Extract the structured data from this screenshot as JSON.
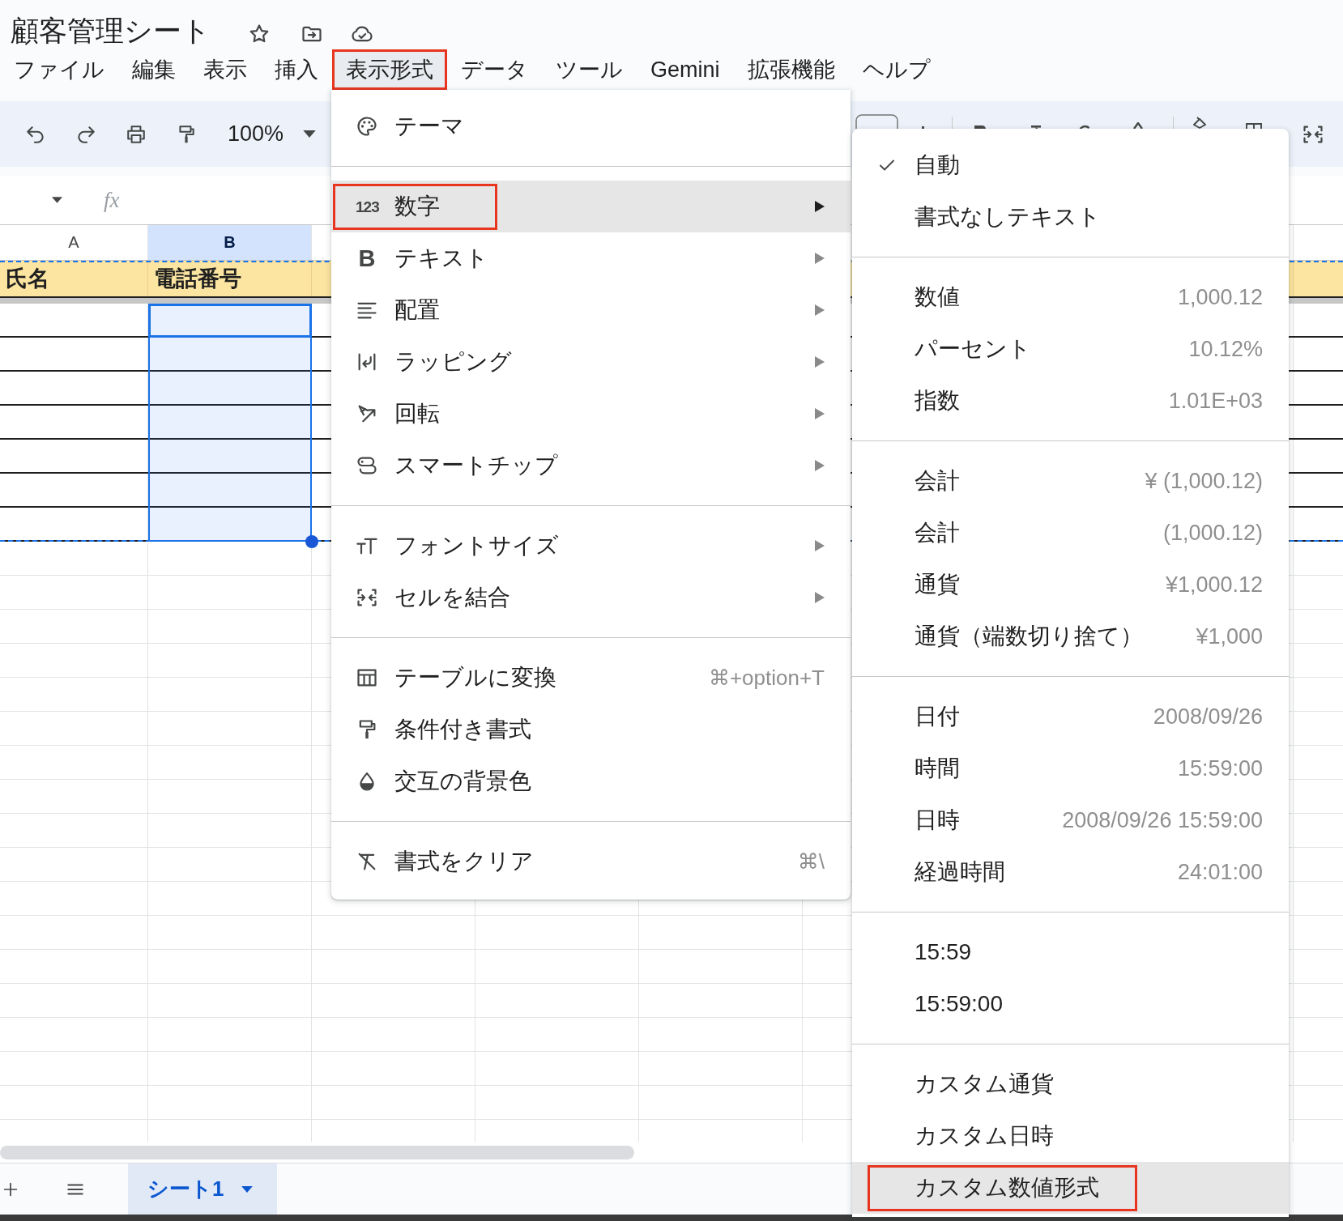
{
  "document": {
    "title": "顧客管理シート"
  },
  "menu_bar": [
    {
      "label": "ファイル",
      "selected": false,
      "callout": false
    },
    {
      "label": "編集",
      "selected": false,
      "callout": false
    },
    {
      "label": "表示",
      "selected": false,
      "callout": false
    },
    {
      "label": "挿入",
      "selected": false,
      "callout": false
    },
    {
      "label": "表示形式",
      "selected": true,
      "callout": true
    },
    {
      "label": "データ",
      "selected": false,
      "callout": false
    },
    {
      "label": "ツール",
      "selected": false,
      "callout": false
    },
    {
      "label": "Gemini",
      "selected": false,
      "callout": false
    },
    {
      "label": "拡張機能",
      "selected": false,
      "callout": false
    },
    {
      "label": "ヘルプ",
      "selected": false,
      "callout": false
    }
  ],
  "toolbar": {
    "zoom": "100%"
  },
  "formula_bar": {
    "function_label": "fx"
  },
  "sheet": {
    "columns": [
      {
        "label": "A",
        "selected": false
      },
      {
        "label": "B",
        "selected": true
      }
    ],
    "header_row": [
      "氏名",
      "電話番号"
    ]
  },
  "sheet_tabs": [
    {
      "label": "シート1",
      "selected": true
    }
  ],
  "format_menu": {
    "sections": [
      [
        {
          "label": "テーマ",
          "submenu": false,
          "selected": false,
          "callout": false
        }
      ],
      [
        {
          "label": "数字",
          "glyph": "123",
          "submenu": true,
          "selected": true,
          "callout": true
        },
        {
          "label": "テキスト",
          "glyph": "B",
          "submenu": true,
          "selected": false,
          "callout": false
        },
        {
          "label": "配置",
          "submenu": true,
          "selected": false,
          "callout": false
        },
        {
          "label": "ラッピング",
          "submenu": true,
          "selected": false,
          "callout": false
        },
        {
          "label": "回転",
          "submenu": true,
          "selected": false,
          "callout": false
        },
        {
          "label": "スマートチップ",
          "submenu": true,
          "selected": false,
          "callout": false
        }
      ],
      [
        {
          "label": "フォントサイズ",
          "submenu": true,
          "selected": false,
          "callout": false
        },
        {
          "label": "セルを結合",
          "submenu": true,
          "selected": false,
          "callout": false
        }
      ],
      [
        {
          "label": "テーブルに変換",
          "shortcut": "⌘+option+T",
          "submenu": false,
          "selected": false,
          "callout": false
        },
        {
          "label": "条件付き書式",
          "submenu": false,
          "selected": false,
          "callout": false
        },
        {
          "label": "交互の背景色",
          "submenu": false,
          "selected": false,
          "callout": false
        }
      ],
      [
        {
          "label": "書式をクリア",
          "shortcut": "⌘\\",
          "submenu": false,
          "selected": false,
          "callout": false
        }
      ]
    ]
  },
  "number_submenu": {
    "sections": [
      [
        {
          "label": "自動",
          "checked": true,
          "selected": false,
          "callout": false
        },
        {
          "label": "書式なしテキスト",
          "checked": false,
          "selected": false,
          "callout": false
        }
      ],
      [
        {
          "label": "数値",
          "example": "1,000.12",
          "checked": false,
          "selected": false,
          "callout": false
        },
        {
          "label": "パーセント",
          "example": "10.12%",
          "checked": false,
          "selected": false,
          "callout": false
        },
        {
          "label": "指数",
          "example": "1.01E+03",
          "checked": false,
          "selected": false,
          "callout": false
        }
      ],
      [
        {
          "label": "会計",
          "example": "¥ (1,000.12)",
          "checked": false,
          "selected": false,
          "callout": false
        },
        {
          "label": "会計",
          "example": "(1,000.12)",
          "checked": false,
          "selected": false,
          "callout": false
        },
        {
          "label": "通貨",
          "example": "¥1,000.12",
          "checked": false,
          "selected": false,
          "callout": false
        },
        {
          "label": "通貨（端数切り捨て）",
          "example": "¥1,000",
          "checked": false,
          "selected": false,
          "callout": false
        }
      ],
      [
        {
          "label": "日付",
          "example": "2008/09/26",
          "checked": false,
          "selected": false,
          "callout": false
        },
        {
          "label": "時間",
          "example": "15:59:00",
          "checked": false,
          "selected": false,
          "callout": false
        },
        {
          "label": "日時",
          "example": "2008/09/26 15:59:00",
          "checked": false,
          "selected": false,
          "callout": false
        },
        {
          "label": "経過時間",
          "example": "24:01:00",
          "checked": false,
          "selected": false,
          "callout": false
        }
      ],
      [
        {
          "label": "15:59",
          "checked": false,
          "selected": false,
          "callout": false
        },
        {
          "label": "15:59:00",
          "checked": false,
          "selected": false,
          "callout": false
        }
      ],
      [
        {
          "label": "カスタム通貨",
          "checked": false,
          "selected": false,
          "callout": false
        },
        {
          "label": "カスタム日時",
          "checked": false,
          "selected": false,
          "callout": false
        },
        {
          "label": "カスタム数値形式",
          "checked": false,
          "selected": true,
          "callout": true
        }
      ]
    ]
  }
}
